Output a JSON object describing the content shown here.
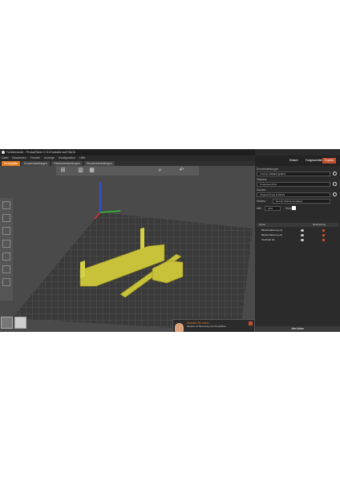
{
  "window": {
    "title": "*Unbenannt - PrusaSlicer 2.3.0 basiert auf Slic3r"
  },
  "menu": [
    "Datei",
    "Bearbeiten",
    "Fenster",
    "Anzeige",
    "Konfiguration",
    "Hilfe"
  ],
  "tabs": [
    {
      "label": "Druckplatte",
      "active": true
    },
    {
      "label": "Druckeinstellungen",
      "active": false
    },
    {
      "label": "Filamenteinstellungen",
      "active": false
    },
    {
      "label": "Druckereinstellungen",
      "active": false
    }
  ],
  "toolbar": {
    "einfach": "Einfach",
    "experte_mid": "Fortgeschritten",
    "experte": "Experte"
  },
  "panel": {
    "druck_label": "Druckeinstellungen:",
    "druck_value": "0.20mm SPEED @MK3",
    "filament_label": "Filament:",
    "filament_value": "Prusament PLA",
    "drucker_label": "Drucker:",
    "drucker_value": "Original Prusa i3 MK3S",
    "stuetzen_label": "Stützen:",
    "stuetzen_value": "Nur für Stützenverstärker",
    "infill_label": "Infill:",
    "infill_value": "15%",
    "rand_label": "Rand:",
    "col_name": "Name",
    "col_edit": "Bearbeitung",
    "objects": [
      "Blinkerhalterung (1)",
      "Blinkerhalterung (2)",
      "Tischhalt (3)"
    ],
    "export_label": "Jetzt slicen"
  },
  "hint": {
    "title": "Wussten Sie schon...",
    "text": "Hinweis zur Benutzung von PrusaSlicer."
  },
  "colors": {
    "accent": "#e07a1f",
    "model": "#c8c23a"
  }
}
